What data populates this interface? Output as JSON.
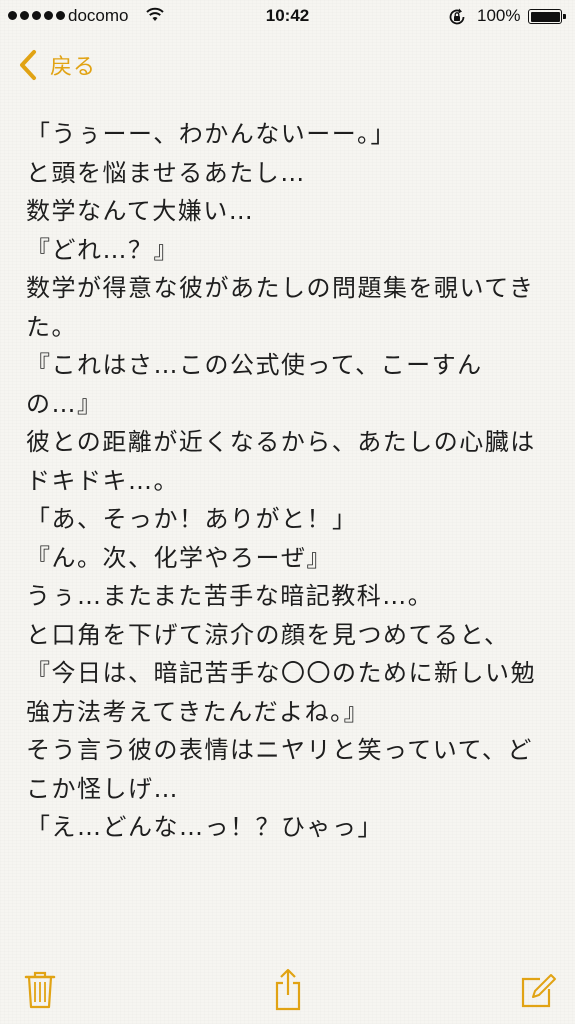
{
  "status_bar": {
    "carrier": "docomo",
    "time": "10:42",
    "battery": "100%",
    "signal_bars_filled": 5
  },
  "nav": {
    "back_label": "戻る"
  },
  "note": {
    "lines": [
      "「うぅーー、わかんないーー。」",
      "と頭を悩ませるあたし…",
      "数学なんて大嫌い…",
      "『どれ…？』",
      "数学が得意な彼があたしの問題集を覗いてき",
      "た。",
      "『これはさ…この公式使って、こーすん",
      "の…』",
      "彼との距離が近くなるから、あたしの心臓は",
      "ドキドキ…。",
      "「あ、そっか！ありがと！」",
      "『ん。次、化学やろーぜ』",
      "うぅ…またまた苦手な暗記教科…。",
      "と口角を下げて涼介の顔を見つめてると、",
      "『今日は、暗記苦手な〇〇のために新しい勉",
      "強方法考えてきたんだよね。』",
      "そう言う彼の表情はニヤリと笑っていて、ど",
      "こか怪しげ…",
      "「え…どんな…っ！？ひゃっ」"
    ]
  },
  "toolbar": {
    "trash_icon": "trash-icon",
    "share_icon": "share-icon",
    "compose_icon": "compose-icon"
  },
  "colors": {
    "accent": "#e1a314",
    "background": "#f6f5f1",
    "text": "#1e1e1e"
  }
}
